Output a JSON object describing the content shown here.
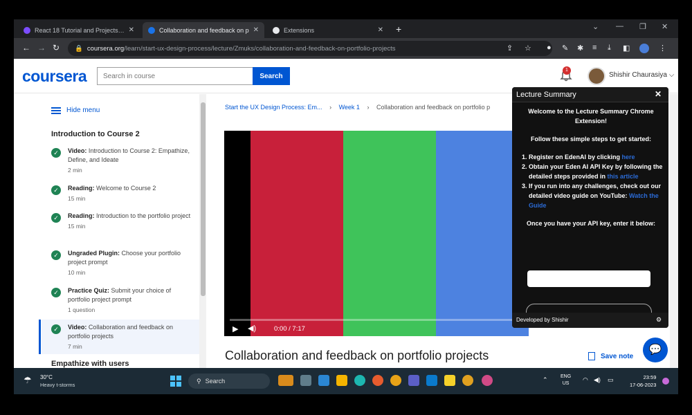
{
  "browser": {
    "tabs": [
      {
        "label": "React 18 Tutorial and Projects Co",
        "fav_color": "#7c4dff"
      },
      {
        "label": "Collaboration and feedback on p",
        "fav_color": "#1a73e8"
      },
      {
        "label": "Extensions",
        "fav_color": "#e8eaed"
      }
    ],
    "url_host": "coursera.org",
    "url_path": "/learn/start-ux-design-process/lecture/Zmuks/collaboration-and-feedback-on-portfolio-projects"
  },
  "header": {
    "logo": "coursera",
    "search_placeholder": "Search in course",
    "search_button": "Search",
    "notification_count": "1",
    "username": "Shishir Chaurasiya"
  },
  "sidebar": {
    "hide_menu": "Hide menu",
    "module_title": "Introduction to Course 2",
    "items": [
      {
        "type": "Video:",
        "title": "Introduction to Course 2: Empathize, Define, and Ideate",
        "duration": "2 min"
      },
      {
        "type": "Reading:",
        "title": "Welcome to Course 2",
        "duration": "15 min"
      },
      {
        "type": "Reading:",
        "title": "Introduction to the portfolio project",
        "duration": "15 min"
      },
      {
        "type": "Ungraded Plugin:",
        "title": "Choose your portfolio project prompt",
        "duration": "10 min"
      },
      {
        "type": "Practice Quiz:",
        "title": "Submit your choice of portfolio project prompt",
        "duration": "1 question"
      },
      {
        "type": "Video:",
        "title": "Collaboration and feedback on portfolio projects",
        "duration": "7 min"
      }
    ],
    "next_module": "Empathize with users"
  },
  "main": {
    "breadcrumb": [
      "Start the UX Design Process: Em...",
      "Week 1",
      "Collaboration and feedback on portfolio p"
    ],
    "video_time": "0:00 / 7:17",
    "video_progress": 0,
    "lecture_title": "Collaboration and feedback on portfolio projects",
    "save_note": "Save note",
    "colors": {
      "red": "#c8203a",
      "green": "#3fc35a",
      "blue": "#4d82e0",
      "accent": "#0056d2"
    }
  },
  "popup": {
    "title": "Lecture Summary",
    "welcome": "Welcome to the Lecture Summary Chrome Extension!",
    "intro": "Follow these simple steps to get started:",
    "step1": "Register on EdenAI by clicking",
    "step1_link": "here",
    "step2": "Obtain your Eden AI API Key by following the detailed steps provided in",
    "step2_link": "this article",
    "step3": "If you run into any challenges, check out our detailed video guide on YouTube:",
    "step3_link": "Watch the Guide",
    "api_prompt": "Once you have your API key, enter it below:",
    "footer": "Developed by Shishir"
  },
  "taskbar": {
    "temperature": "30°C",
    "weather": "Heavy t-storms",
    "search": "Search",
    "lang_top": "ENG",
    "lang_bottom": "US",
    "time": "23:59",
    "date": "17-06-2023"
  }
}
